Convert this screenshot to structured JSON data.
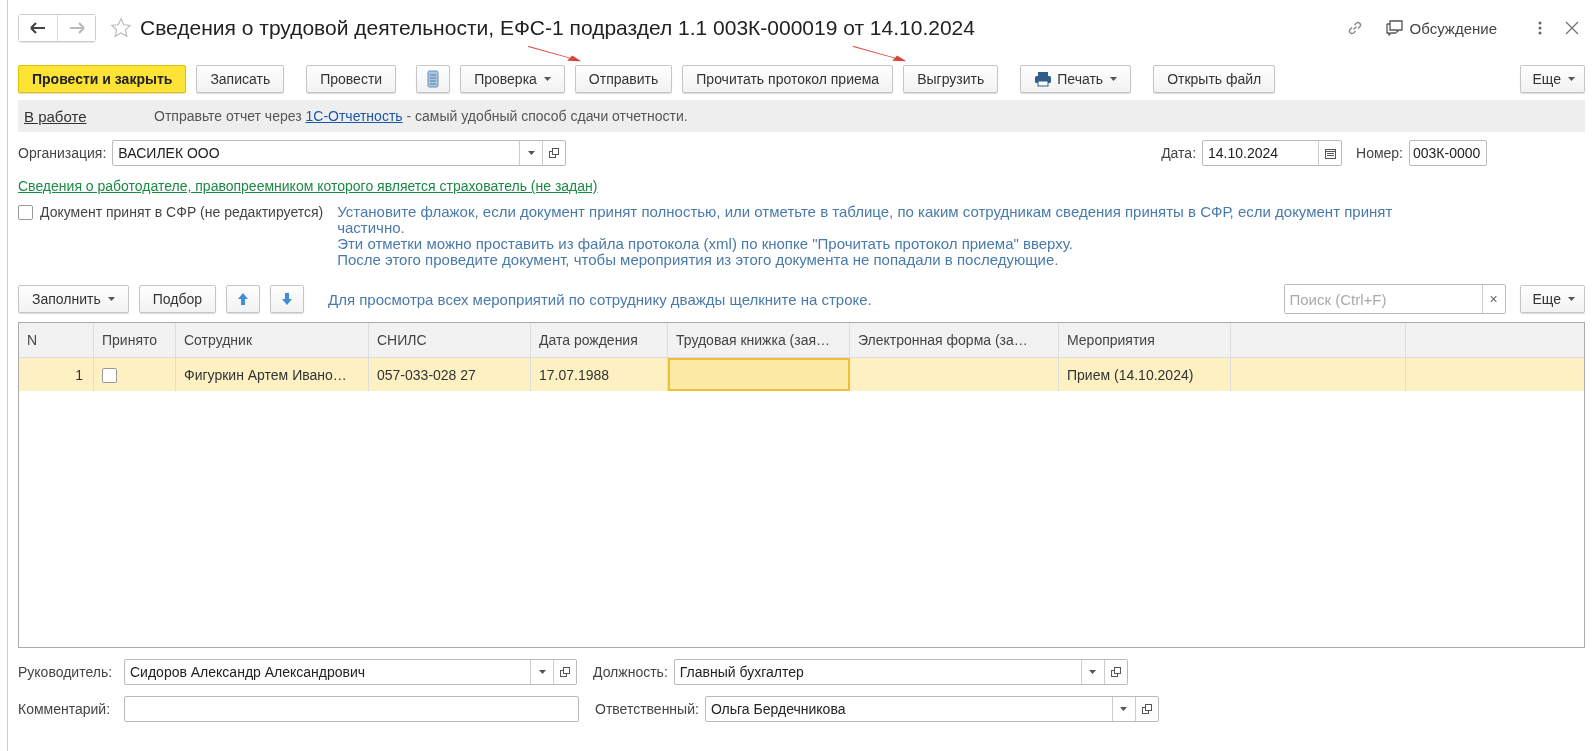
{
  "window": {
    "title": "Сведения о трудовой деятельности, ЕФС-1 подраздел 1.1 003К-000019 от 14.10.2024",
    "favorite": false,
    "discussion": "Обсуждение"
  },
  "toolbar": [
    {
      "kind": "primary",
      "label": "Провести и закрыть"
    },
    {
      "kind": "plain",
      "label": "Записать"
    },
    {
      "kind": "plain",
      "label": "Провести"
    },
    {
      "kind": "icon"
    },
    {
      "kind": "dropdown",
      "label": "Проверка"
    },
    {
      "kind": "plain",
      "label": "Отправить"
    },
    {
      "kind": "plain",
      "label": "Прочитать протокол приема"
    },
    {
      "kind": "plain",
      "label": "Выгрузить"
    },
    {
      "kind": "print",
      "label": "Печать"
    },
    {
      "kind": "plain",
      "label": "Открыть файл"
    },
    {
      "kind": "more",
      "label": "Еще"
    }
  ],
  "status_bar": {
    "state": "В работе",
    "before": "Отправьте отчет через ",
    "link": "1С-Отчетность",
    "after": " - самый удобный способ сдачи отчетности."
  },
  "organization": {
    "label": "Организация:",
    "value": "ВАСИЛЕК ООО"
  },
  "date": {
    "label": "Дата:",
    "value": "14.10.2024"
  },
  "number": {
    "label": "Номер:",
    "value": "003К-0000"
  },
  "employer_link": "Сведения о работодателе, правопреемником которого является страхователь (не задан)",
  "accepted": {
    "label": "Документ принят в СФР (не редактируется)",
    "checked": false
  },
  "hint": [
    "Установите флажок, если документ принят полностью, или отметьте в таблице, по каким сотрудникам сведения приняты в СФР, если документ принят частично.",
    "Эти отметки можно проставить из файла протокола (xml) по кнопке \"Прочитать протокол приема\" вверху.",
    "После этого проведите документ, чтобы мероприятия из этого документа не попадали в последующие."
  ],
  "table_toolbar": {
    "fill": "Заполнить",
    "pick": "Подбор",
    "hint": "Для просмотра всех мероприятий по сотруднику дважды щелкните на строке.",
    "search": {
      "placeholder": "Поиск (Ctrl+F)",
      "clear": "×"
    },
    "more": "Еще"
  },
  "table": {
    "columns": [
      "N",
      "Принято",
      "Сотрудник",
      "СНИЛС",
      "Дата рождения",
      "Трудовая книжка (зая…",
      "Электронная форма (за…",
      "Мероприятия"
    ],
    "rows": [
      {
        "selected": true,
        "cells": [
          {
            "kind": "text",
            "text": "1",
            "focused": false
          },
          {
            "kind": "checkbox",
            "checked": false
          },
          {
            "kind": "text",
            "text": "Фигуркин Артем Ивано…",
            "focused": false
          },
          {
            "kind": "text",
            "text": "057-033-028 27",
            "focused": false
          },
          {
            "kind": "text",
            "text": "17.07.1988",
            "focused": false
          },
          {
            "kind": "text",
            "text": "",
            "focused": true
          },
          {
            "kind": "text",
            "text": "",
            "focused": false
          },
          {
            "kind": "text",
            "text": "Прием (14.10.2024)",
            "focused": false
          }
        ]
      }
    ]
  },
  "manager": {
    "label": "Руководитель:",
    "value": "Сидоров Александр Александрович"
  },
  "position": {
    "label": "Должность:",
    "value": "Главный бухгалтер"
  },
  "comment": {
    "label": "Комментарий:"
  },
  "responsible": {
    "label": "Ответственный:",
    "value": "Ольга Бердечникова"
  }
}
